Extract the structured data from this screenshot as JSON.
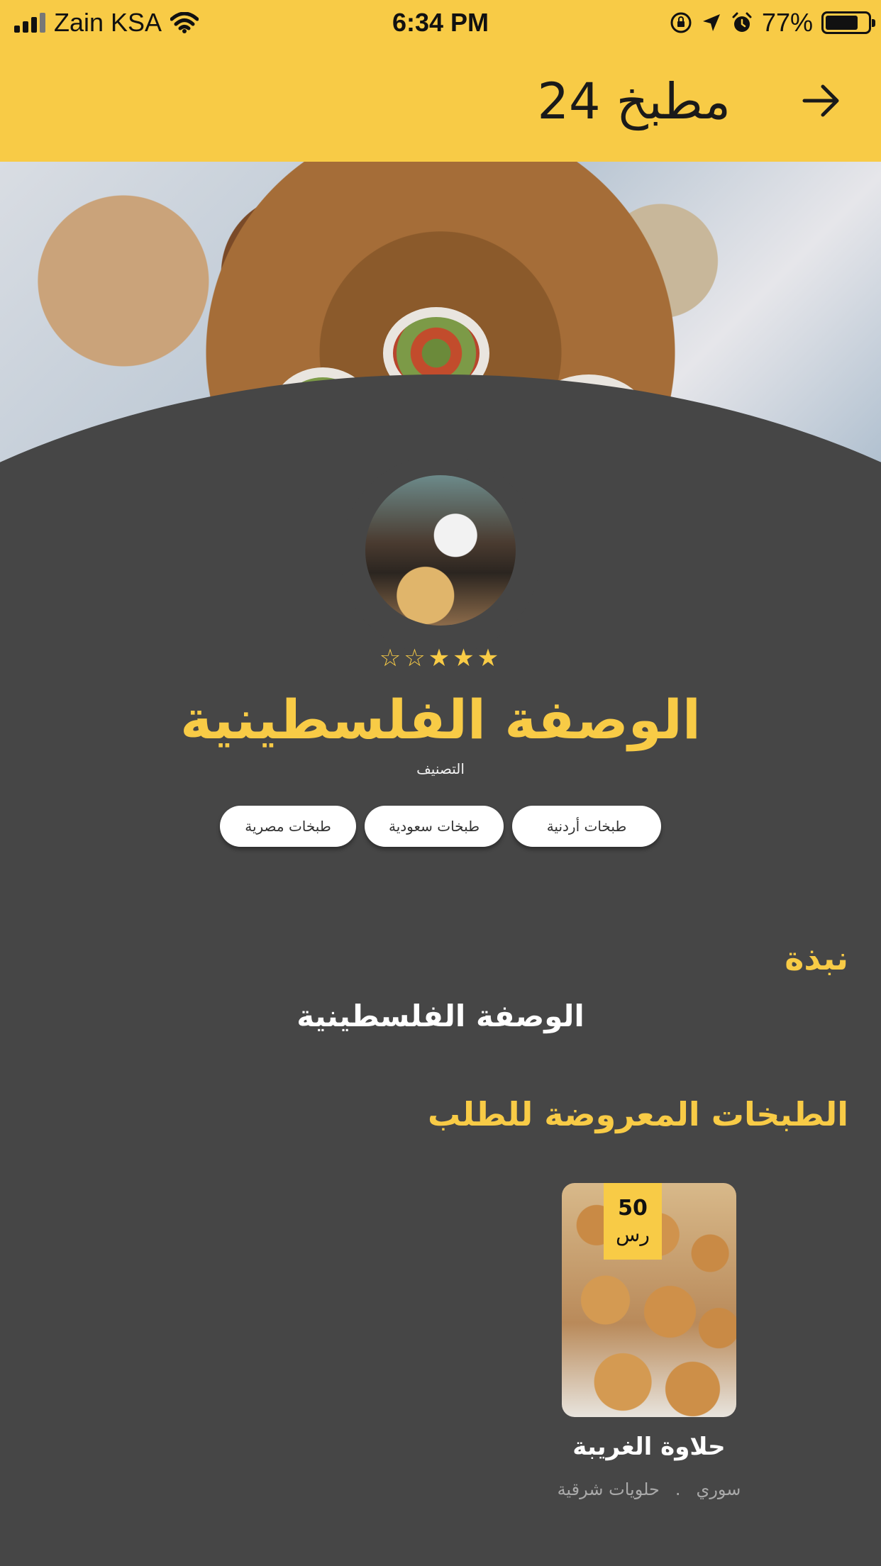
{
  "status_bar": {
    "carrier": "Zain KSA",
    "time": "6:34 PM",
    "battery": "77%",
    "battery_level": 0.77
  },
  "header": {
    "title": "مطبخ 24"
  },
  "profile": {
    "rating_stars": "☆☆★★★",
    "rating": 3,
    "rating_max": 5,
    "title": "الوصفة الفلسطينية",
    "category_label": "التصنيف",
    "categories": [
      "طبخات أردنية",
      "طبخات سعودية",
      "طبخات مصرية"
    ]
  },
  "about": {
    "heading": "نبذة",
    "text": "الوصفة الفلسطينية"
  },
  "dishes_section": {
    "heading": "الطبخات المعروضة للطلب",
    "items": [
      {
        "price": "50",
        "currency": "رس",
        "name": "حلاوة الغريبة",
        "cuisine": "سوري",
        "separator": ".",
        "type": "حلويات شرقية"
      }
    ]
  },
  "colors": {
    "accent": "#f8cb46",
    "background": "#464646",
    "text": "#ffffff"
  }
}
